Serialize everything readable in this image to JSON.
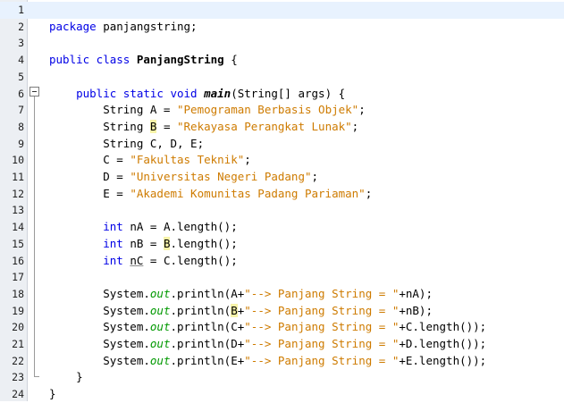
{
  "editor": {
    "line_numbers": [
      "1",
      "2",
      "3",
      "4",
      "5",
      "6",
      "7",
      "8",
      "9",
      "10",
      "11",
      "12",
      "13",
      "14",
      "15",
      "16",
      "17",
      "18",
      "19",
      "20",
      "21",
      "22",
      "23",
      "24"
    ],
    "lines": [
      [],
      [
        {
          "t": "package",
          "c": "kw"
        },
        {
          "t": " panjangstring;"
        }
      ],
      [],
      [
        {
          "t": "public class",
          "c": "kw"
        },
        {
          "t": " "
        },
        {
          "t": "PanjangString",
          "c": "bold"
        },
        {
          "t": " {"
        }
      ],
      [],
      [
        {
          "t": "    "
        },
        {
          "t": "public static void",
          "c": "kw"
        },
        {
          "t": " "
        },
        {
          "t": "main",
          "c": "boldit"
        },
        {
          "t": "(String[] args) {"
        }
      ],
      [
        {
          "t": "        String A = "
        },
        {
          "t": "\"Pemograman Berbasis Objek\"",
          "c": "str"
        },
        {
          "t": ";"
        }
      ],
      [
        {
          "t": "        String "
        },
        {
          "t": "B",
          "c": "hl"
        },
        {
          "t": " = "
        },
        {
          "t": "\"Rekayasa Perangkat Lunak\"",
          "c": "str"
        },
        {
          "t": ";"
        }
      ],
      [
        {
          "t": "        String C, D, E;"
        }
      ],
      [
        {
          "t": "        C = "
        },
        {
          "t": "\"Fakultas Teknik\"",
          "c": "str"
        },
        {
          "t": ";"
        }
      ],
      [
        {
          "t": "        D = "
        },
        {
          "t": "\"Universitas Negeri Padang\"",
          "c": "str"
        },
        {
          "t": ";"
        }
      ],
      [
        {
          "t": "        E = "
        },
        {
          "t": "\"Akademi Komunitas Padang Pariaman\"",
          "c": "str"
        },
        {
          "t": ";"
        }
      ],
      [],
      [
        {
          "t": "        "
        },
        {
          "t": "int",
          "c": "kw"
        },
        {
          "t": " nA = A.length();"
        }
      ],
      [
        {
          "t": "        "
        },
        {
          "t": "int",
          "c": "kw"
        },
        {
          "t": " nB = "
        },
        {
          "t": "B",
          "c": "hl"
        },
        {
          "t": ".length();"
        }
      ],
      [
        {
          "t": "        "
        },
        {
          "t": "int",
          "c": "kw"
        },
        {
          "t": " "
        },
        {
          "t": "nC",
          "c": "ul"
        },
        {
          "t": " = C.length();"
        }
      ],
      [],
      [
        {
          "t": "        System."
        },
        {
          "t": "out",
          "c": "out"
        },
        {
          "t": ".println(A+"
        },
        {
          "t": "\"--> Panjang String = \"",
          "c": "str"
        },
        {
          "t": "+nA);"
        }
      ],
      [
        {
          "t": "        System."
        },
        {
          "t": "out",
          "c": "out"
        },
        {
          "t": ".println("
        },
        {
          "t": "B",
          "c": "hl"
        },
        {
          "t": "+"
        },
        {
          "t": "\"--> Panjang String = \"",
          "c": "str"
        },
        {
          "t": "+nB);"
        }
      ],
      [
        {
          "t": "        System."
        },
        {
          "t": "out",
          "c": "out"
        },
        {
          "t": ".println(C+"
        },
        {
          "t": "\"--> Panjang String = \"",
          "c": "str"
        },
        {
          "t": "+C.length());"
        }
      ],
      [
        {
          "t": "        System."
        },
        {
          "t": "out",
          "c": "out"
        },
        {
          "t": ".println(D+"
        },
        {
          "t": "\"--> Panjang String = \"",
          "c": "str"
        },
        {
          "t": "+D.length());"
        }
      ],
      [
        {
          "t": "        System."
        },
        {
          "t": "out",
          "c": "out"
        },
        {
          "t": ".println(E+"
        },
        {
          "t": "\"--> Panjang String = \"",
          "c": "str"
        },
        {
          "t": "+E.length());"
        }
      ],
      [
        {
          "t": "    }"
        }
      ],
      [
        {
          "t": "}"
        }
      ]
    ]
  },
  "icons": {
    "fold_toggle": "fold-minus-icon"
  },
  "colors": {
    "keyword": "#0000e6",
    "string": "#ce7b00",
    "static_field": "#009900",
    "gutter": "#eceff3",
    "current_line": "#e8f2fe",
    "occurrence_highlight": "#f7f3a8"
  }
}
